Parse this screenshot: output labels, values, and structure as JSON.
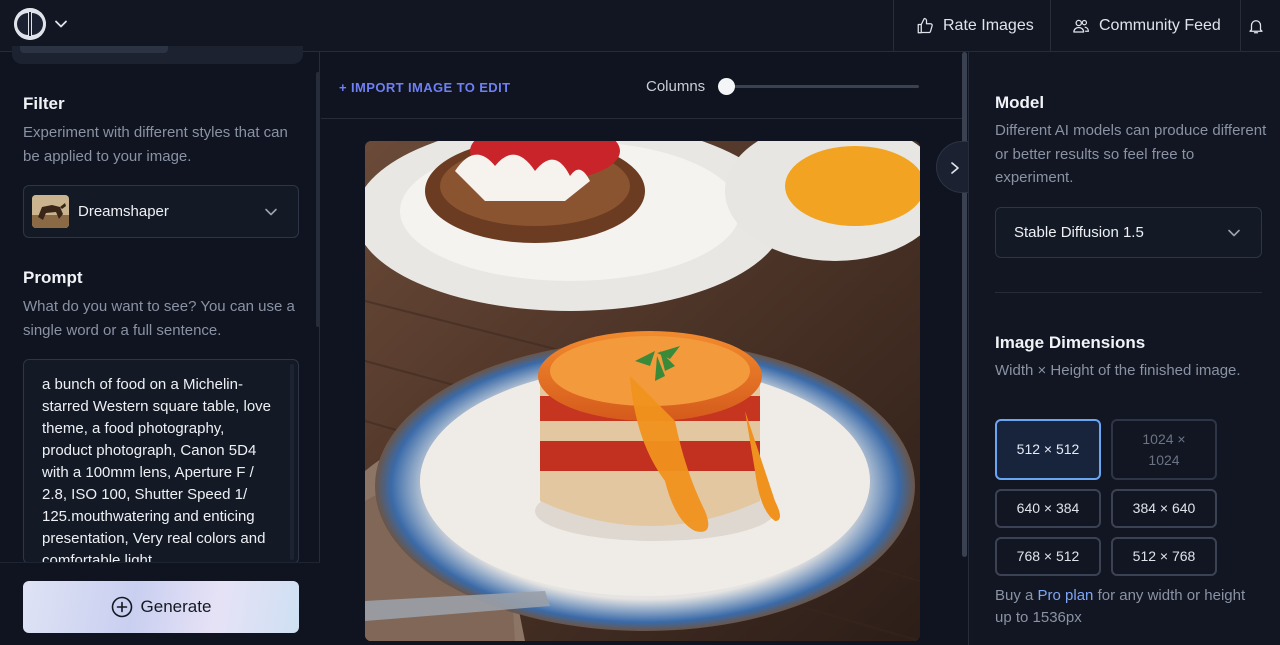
{
  "topbar": {
    "rate_label": "Rate Images",
    "community_label": "Community Feed"
  },
  "left": {
    "filter": {
      "title": "Filter",
      "desc": "Experiment with different styles that can be applied to your image.",
      "selected": "Dreamshaper"
    },
    "prompt": {
      "title": "Prompt",
      "desc": "What do you want to see? You can use a single word or a full sentence.",
      "value": "a bunch of food on a Michelin-starred Western square table, love theme, a food photography, product photograph, Canon 5D4 with a 100mm lens, Aperture F / 2.8, ISO 100, Shutter Speed 1/ 125.mouthwatering and enticing presentation, Very real colors and comfortable light"
    },
    "generate_label": "Generate"
  },
  "center": {
    "import_label": "+ IMPORT IMAGE TO EDIT",
    "columns_label": "Columns",
    "columns_value": 0
  },
  "right": {
    "model": {
      "title": "Model",
      "desc": "Different AI models can produce different or better results so feel free to experiment.",
      "selected": "Stable Diffusion 1.5"
    },
    "dimensions": {
      "title": "Image Dimensions",
      "desc": "Width × Height of the finished image.",
      "options": [
        "512 × 512",
        "1024 × 1024",
        "640 × 384",
        "384 × 640",
        "768 × 512",
        "512 × 768"
      ],
      "selected": "512 × 512"
    },
    "pro_note": {
      "prefix": "Buy a ",
      "link": "Pro plan",
      "suffix": " for any width or height up to 1536px"
    }
  },
  "colors": {
    "background": "#0f1420",
    "accent": "#6f7ff4",
    "selected_border": "#6aa6f2"
  }
}
